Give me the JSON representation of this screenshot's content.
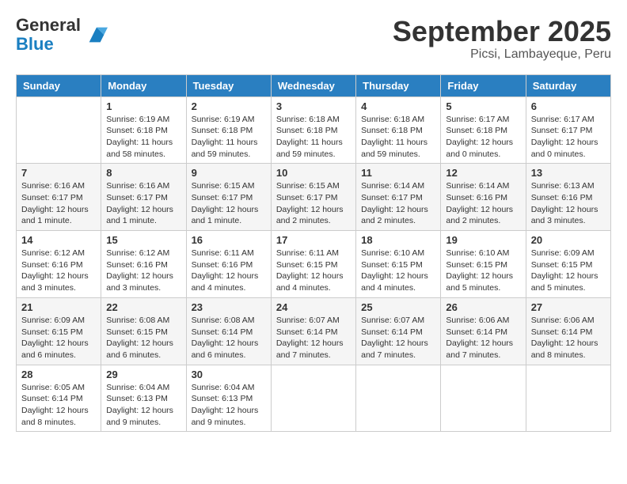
{
  "logo": {
    "general": "General",
    "blue": "Blue"
  },
  "title": "September 2025",
  "location": "Picsi, Lambayeque, Peru",
  "weekdays": [
    "Sunday",
    "Monday",
    "Tuesday",
    "Wednesday",
    "Thursday",
    "Friday",
    "Saturday"
  ],
  "weeks": [
    [
      {
        "day": "",
        "info": ""
      },
      {
        "day": "1",
        "info": "Sunrise: 6:19 AM\nSunset: 6:18 PM\nDaylight: 11 hours\nand 58 minutes."
      },
      {
        "day": "2",
        "info": "Sunrise: 6:19 AM\nSunset: 6:18 PM\nDaylight: 11 hours\nand 59 minutes."
      },
      {
        "day": "3",
        "info": "Sunrise: 6:18 AM\nSunset: 6:18 PM\nDaylight: 11 hours\nand 59 minutes."
      },
      {
        "day": "4",
        "info": "Sunrise: 6:18 AM\nSunset: 6:18 PM\nDaylight: 11 hours\nand 59 minutes."
      },
      {
        "day": "5",
        "info": "Sunrise: 6:17 AM\nSunset: 6:18 PM\nDaylight: 12 hours\nand 0 minutes."
      },
      {
        "day": "6",
        "info": "Sunrise: 6:17 AM\nSunset: 6:17 PM\nDaylight: 12 hours\nand 0 minutes."
      }
    ],
    [
      {
        "day": "7",
        "info": "Sunrise: 6:16 AM\nSunset: 6:17 PM\nDaylight: 12 hours\nand 1 minute."
      },
      {
        "day": "8",
        "info": "Sunrise: 6:16 AM\nSunset: 6:17 PM\nDaylight: 12 hours\nand 1 minute."
      },
      {
        "day": "9",
        "info": "Sunrise: 6:15 AM\nSunset: 6:17 PM\nDaylight: 12 hours\nand 1 minute."
      },
      {
        "day": "10",
        "info": "Sunrise: 6:15 AM\nSunset: 6:17 PM\nDaylight: 12 hours\nand 2 minutes."
      },
      {
        "day": "11",
        "info": "Sunrise: 6:14 AM\nSunset: 6:17 PM\nDaylight: 12 hours\nand 2 minutes."
      },
      {
        "day": "12",
        "info": "Sunrise: 6:14 AM\nSunset: 6:16 PM\nDaylight: 12 hours\nand 2 minutes."
      },
      {
        "day": "13",
        "info": "Sunrise: 6:13 AM\nSunset: 6:16 PM\nDaylight: 12 hours\nand 3 minutes."
      }
    ],
    [
      {
        "day": "14",
        "info": "Sunrise: 6:12 AM\nSunset: 6:16 PM\nDaylight: 12 hours\nand 3 minutes."
      },
      {
        "day": "15",
        "info": "Sunrise: 6:12 AM\nSunset: 6:16 PM\nDaylight: 12 hours\nand 3 minutes."
      },
      {
        "day": "16",
        "info": "Sunrise: 6:11 AM\nSunset: 6:16 PM\nDaylight: 12 hours\nand 4 minutes."
      },
      {
        "day": "17",
        "info": "Sunrise: 6:11 AM\nSunset: 6:15 PM\nDaylight: 12 hours\nand 4 minutes."
      },
      {
        "day": "18",
        "info": "Sunrise: 6:10 AM\nSunset: 6:15 PM\nDaylight: 12 hours\nand 4 minutes."
      },
      {
        "day": "19",
        "info": "Sunrise: 6:10 AM\nSunset: 6:15 PM\nDaylight: 12 hours\nand 5 minutes."
      },
      {
        "day": "20",
        "info": "Sunrise: 6:09 AM\nSunset: 6:15 PM\nDaylight: 12 hours\nand 5 minutes."
      }
    ],
    [
      {
        "day": "21",
        "info": "Sunrise: 6:09 AM\nSunset: 6:15 PM\nDaylight: 12 hours\nand 6 minutes."
      },
      {
        "day": "22",
        "info": "Sunrise: 6:08 AM\nSunset: 6:15 PM\nDaylight: 12 hours\nand 6 minutes."
      },
      {
        "day": "23",
        "info": "Sunrise: 6:08 AM\nSunset: 6:14 PM\nDaylight: 12 hours\nand 6 minutes."
      },
      {
        "day": "24",
        "info": "Sunrise: 6:07 AM\nSunset: 6:14 PM\nDaylight: 12 hours\nand 7 minutes."
      },
      {
        "day": "25",
        "info": "Sunrise: 6:07 AM\nSunset: 6:14 PM\nDaylight: 12 hours\nand 7 minutes."
      },
      {
        "day": "26",
        "info": "Sunrise: 6:06 AM\nSunset: 6:14 PM\nDaylight: 12 hours\nand 7 minutes."
      },
      {
        "day": "27",
        "info": "Sunrise: 6:06 AM\nSunset: 6:14 PM\nDaylight: 12 hours\nand 8 minutes."
      }
    ],
    [
      {
        "day": "28",
        "info": "Sunrise: 6:05 AM\nSunset: 6:14 PM\nDaylight: 12 hours\nand 8 minutes."
      },
      {
        "day": "29",
        "info": "Sunrise: 6:04 AM\nSunset: 6:13 PM\nDaylight: 12 hours\nand 9 minutes."
      },
      {
        "day": "30",
        "info": "Sunrise: 6:04 AM\nSunset: 6:13 PM\nDaylight: 12 hours\nand 9 minutes."
      },
      {
        "day": "",
        "info": ""
      },
      {
        "day": "",
        "info": ""
      },
      {
        "day": "",
        "info": ""
      },
      {
        "day": "",
        "info": ""
      }
    ]
  ]
}
